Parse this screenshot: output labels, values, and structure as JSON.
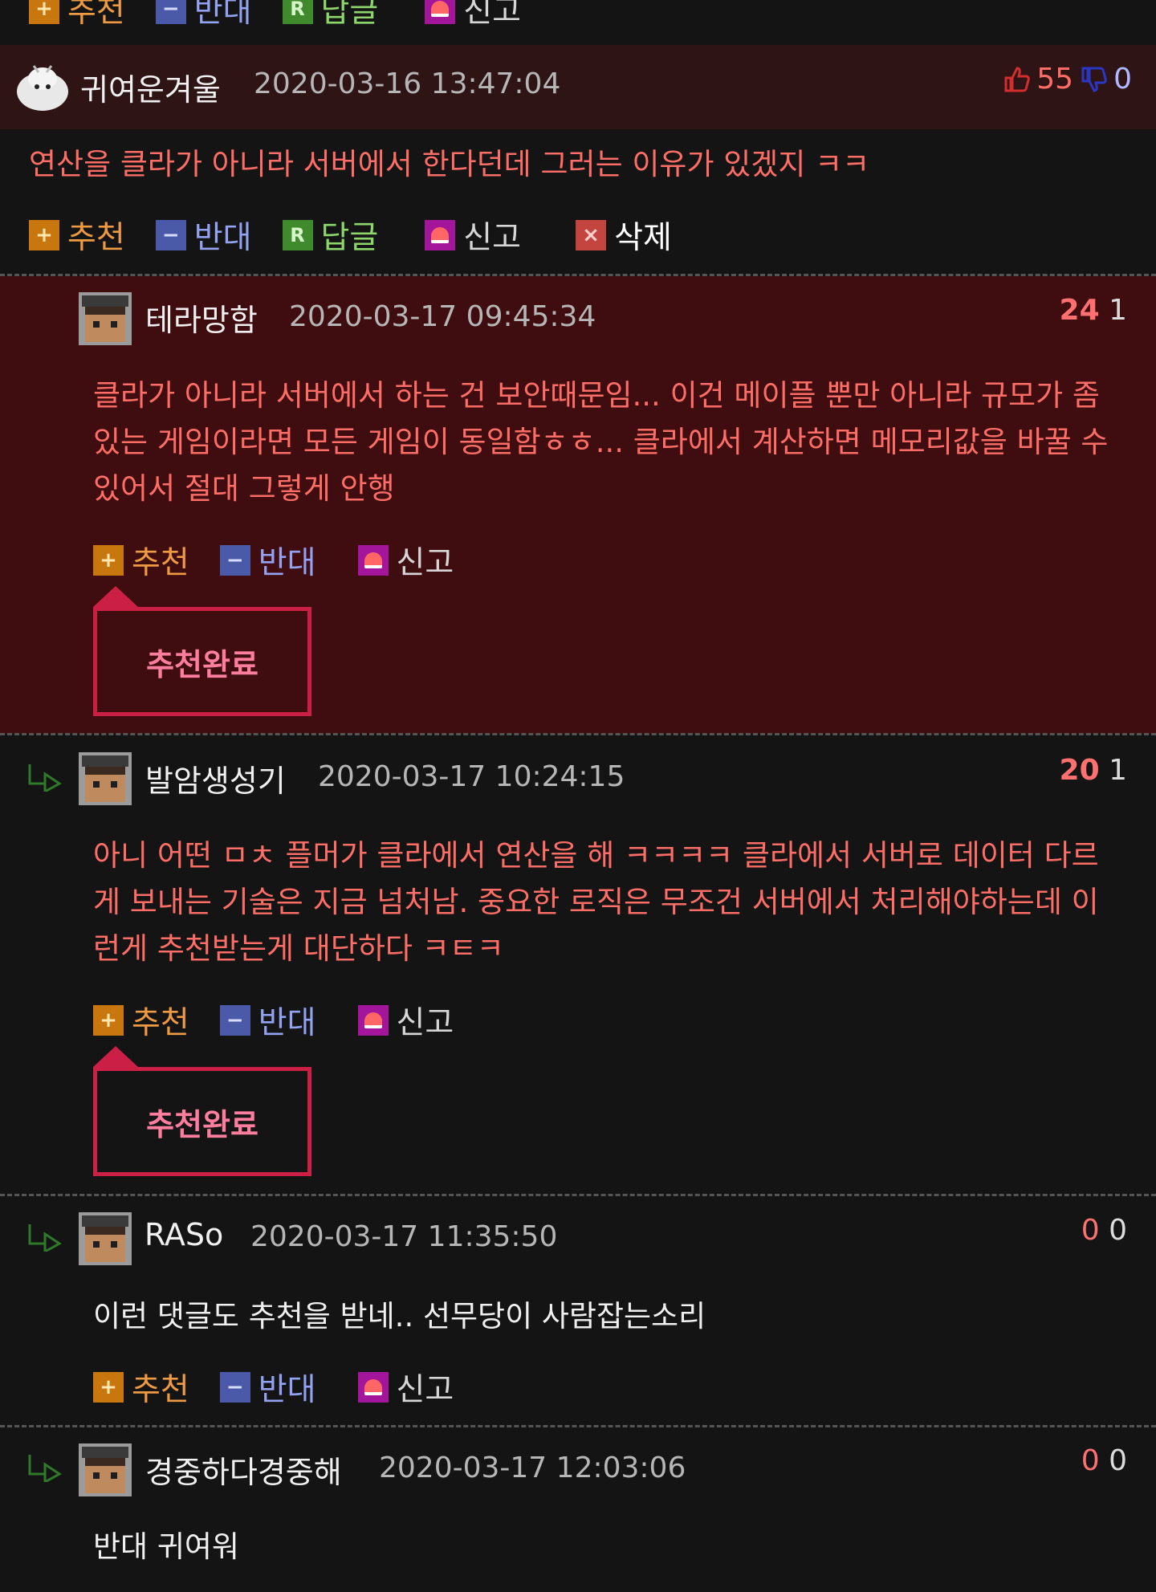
{
  "actions": {
    "up": "추천",
    "down": "반대",
    "reply": "답글",
    "report": "신고",
    "delete": "삭제"
  },
  "done_label": "추천완료",
  "comments": [
    {
      "name": "귀여운겨울",
      "time": "2020-03-16 13:47:04",
      "up": "55",
      "down": "0",
      "body": "연산을 클라가 아니라 서버에서 한다던데 그러는 이유가 있겠지 ㅋㅋ"
    },
    {
      "name": "테라망함",
      "time": "2020-03-17 09:45:34",
      "up": "24",
      "down": "1",
      "body": "클라가 아니라 서버에서 하는 건 보안때문임... 이건 메이플 뿐만 아니라 규모가 좀 있는 게임이라면 모든 게임이 동일함ㅎㅎ... 클라에서 계산하면 메모리값을 바꿀 수 있어서 절대 그렇게 안행"
    },
    {
      "name": "발암생성기",
      "time": "2020-03-17 10:24:15",
      "up": "20",
      "down": "1",
      "body": "아니 어떤 ㅁㅊ 플머가 클라에서 연산을 해 ㅋㅋㅋㅋ 클라에서 서버로 데이터 다르게 보내는 기술은 지금 넘처남. 중요한 로직은 무조건 서버에서 처리해야하는데 이런게 추천받는게 대단하다 ㅋㅌㅋ"
    },
    {
      "name": "RASo",
      "time": "2020-03-17 11:35:50",
      "up": "0",
      "down": "0",
      "body": "이런 댓글도 추천을 받네.. 선무당이 사람잡는소리"
    },
    {
      "name": "경중하다경중해",
      "time": "2020-03-17 12:03:06",
      "up": "0",
      "down": "0",
      "body": "반대 귀여워"
    }
  ],
  "colors": {
    "highlight_bg": "#3f0d0f",
    "top_bg": "#2e1415",
    "page_bg": "#141414",
    "accent": "#cc1f45"
  }
}
